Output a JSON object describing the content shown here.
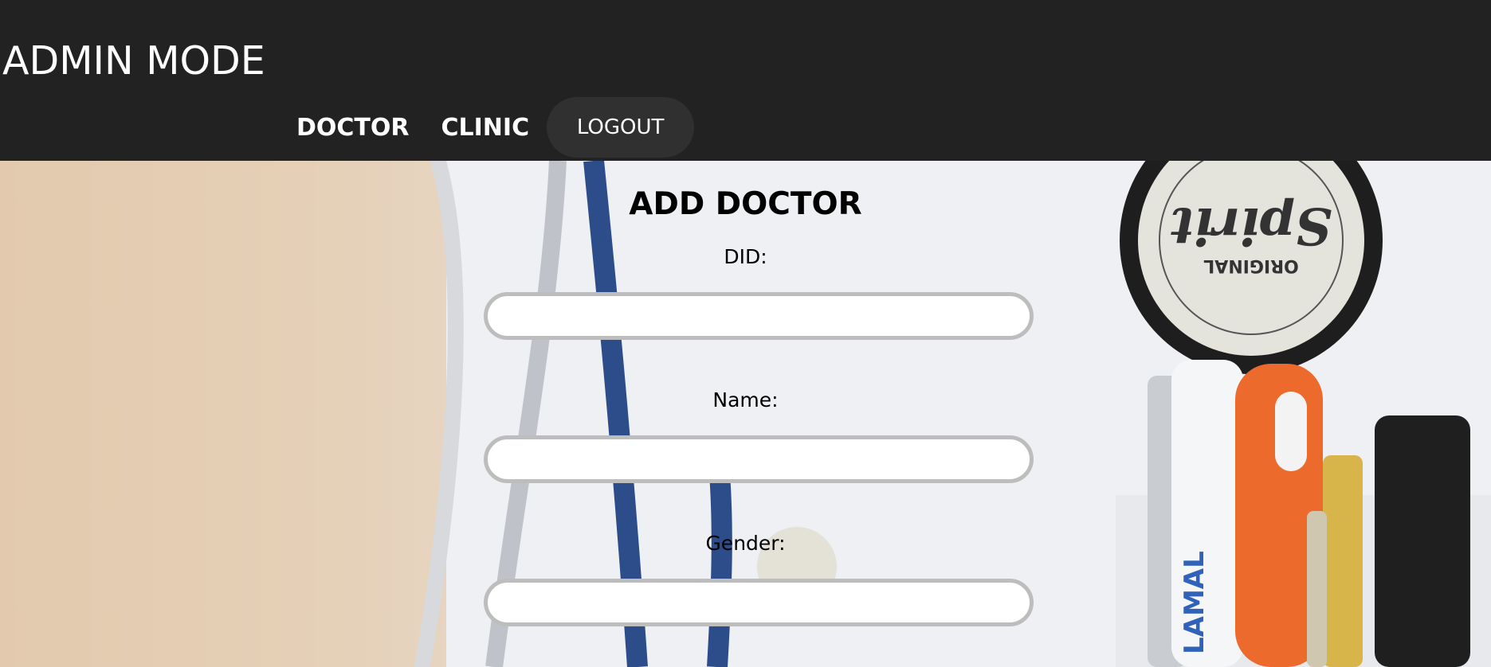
{
  "header": {
    "brand": "ADMIN MODE",
    "nav": [
      {
        "label": "DOCTOR"
      },
      {
        "label": "CLINIC"
      }
    ],
    "logout_label": "LOGOUT"
  },
  "form": {
    "title": "ADD DOCTOR",
    "fields": [
      {
        "label": "DID:",
        "value": "",
        "placeholder": ""
      },
      {
        "label": "Name:",
        "value": "",
        "placeholder": ""
      },
      {
        "label": "Gender:",
        "value": "",
        "placeholder": ""
      }
    ]
  },
  "background": {
    "badge_brand": "Spirit",
    "badge_sub": "ORIGINAL",
    "pen_brand": "LAMAL"
  },
  "colors": {
    "header_bg": "#222222",
    "logout_bg": "#303030",
    "input_border": "#bdbdbd"
  }
}
